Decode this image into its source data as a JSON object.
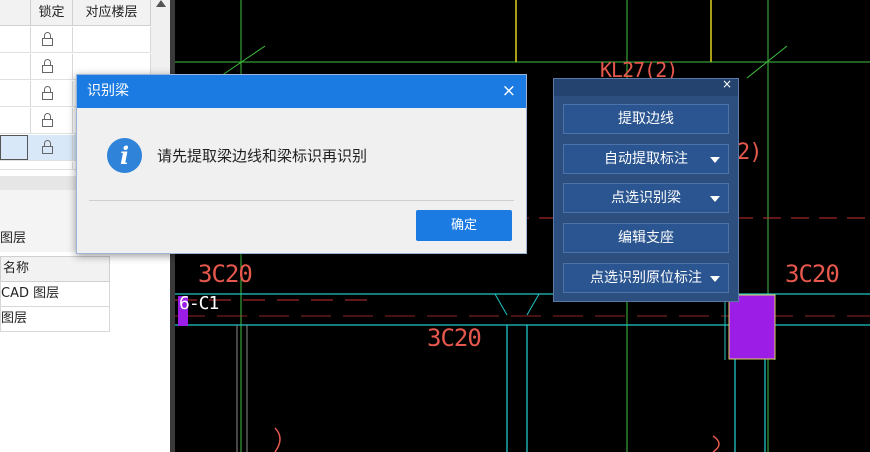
{
  "left_table": {
    "headers": [
      "锁定",
      "对应楼层"
    ],
    "rows": [
      {
        "locked": true,
        "floor": ""
      },
      {
        "locked": true,
        "floor": ""
      },
      {
        "locked": true,
        "floor": ""
      },
      {
        "locked": true,
        "floor": ""
      },
      {
        "locked": true,
        "floor": ""
      }
    ]
  },
  "layer_panel": {
    "title": "图层",
    "header": "名称",
    "rows": [
      "CAD 图层",
      "图层"
    ]
  },
  "dialog": {
    "title": "识别梁",
    "message": "请先提取梁边线和梁标识再识别",
    "ok_label": "确定",
    "close_symbol": "×"
  },
  "tool_panel": {
    "close_symbol": "×",
    "buttons": [
      {
        "label": "提取边线",
        "dropdown": false
      },
      {
        "label": "自动提取标注",
        "dropdown": true
      },
      {
        "label": "点选识别梁",
        "dropdown": true
      },
      {
        "label": "编辑支座",
        "dropdown": false
      },
      {
        "label": "点选识别原位标注",
        "dropdown": true
      }
    ]
  },
  "cad": {
    "labels": [
      "3C20",
      "3C20",
      "3C20",
      "6-C1",
      "KL27(2)",
      "2)"
    ],
    "colors": {
      "background": "#000000",
      "text_red": "#e6584d",
      "cyan": "#22c5c5",
      "yellow": "#e0d020",
      "green": "#3fbf3f",
      "purple": "#9b1de6"
    }
  }
}
